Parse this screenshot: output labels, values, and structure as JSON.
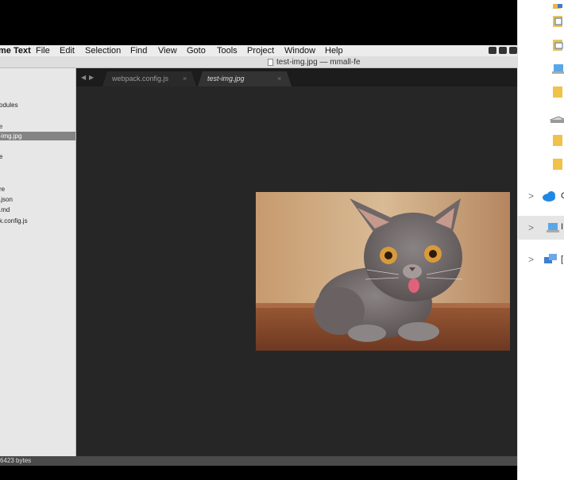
{
  "menubar": {
    "app_name": "me Text",
    "items": [
      "File",
      "Edit",
      "Selection",
      "Find",
      "View",
      "Goto",
      "Tools",
      "Project",
      "Window",
      "Help"
    ]
  },
  "window": {
    "title": "test-img.jpg — mmall-fe"
  },
  "sidebar": {
    "items": [
      {
        "label": "odules"
      },
      {
        "label": "e"
      },
      {
        "label": "-img.jpg",
        "selected": true
      },
      {
        "label": "e"
      },
      {
        "label": "re"
      },
      {
        "label": ".json"
      },
      {
        "label": ".md"
      },
      {
        "label": "k.config.js"
      }
    ]
  },
  "tabs": [
    {
      "label": "webpack.config.js",
      "close": "×",
      "active": false
    },
    {
      "label": "test-img.jpg",
      "close": "×",
      "active": true
    }
  ],
  "nav": {
    "back": "◀",
    "forward": "▶"
  },
  "image": {
    "subject": "cat-photo"
  },
  "status": {
    "text": "6423 bytes"
  },
  "explorer": {
    "rows": [
      "C",
      "I",
      "["
    ]
  },
  "colors": {
    "editor_bg": "#262626",
    "selected_item": "#848484",
    "status_bar": "#4a4a4a"
  }
}
